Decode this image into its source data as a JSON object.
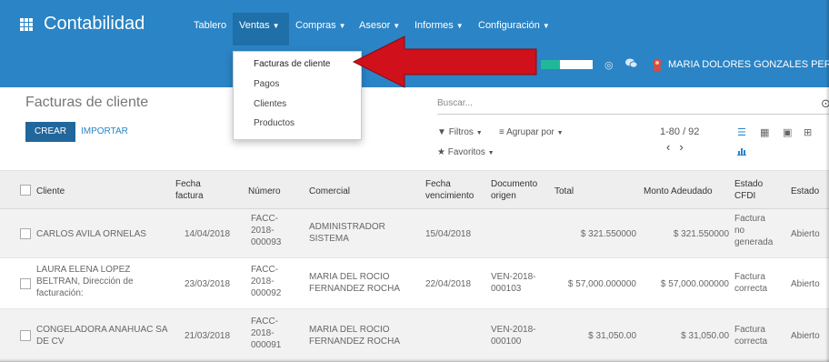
{
  "app": {
    "title": "Contabilidad",
    "apps_icon": "grid-icon"
  },
  "nav": {
    "tablero": "Tablero",
    "ventas": "Ventas",
    "compras": "Compras",
    "asesor": "Asesor",
    "informes": "Informes",
    "configuracion": "Configuración"
  },
  "dropdown": {
    "items": [
      "Facturas de cliente",
      "Pagos",
      "Clientes",
      "Productos"
    ],
    "active_index": 0
  },
  "topbar": {
    "progress_fraction": 0.37,
    "progress_colors": {
      "fill": "#21b799",
      "track": "#ffffff"
    },
    "user_name": "MARIA DOLORES GONZALES PERE"
  },
  "control": {
    "title": "Facturas de cliente",
    "crear": "CREAR",
    "importar": "IMPORTAR",
    "search_placeholder": "Buscar...",
    "filtros": "Filtros",
    "agrupar": "Agrupar por",
    "favoritos": "Favoritos",
    "pager": "1-80 / 92"
  },
  "table": {
    "headers": {
      "cliente": "Cliente",
      "fecha_factura_1": "Fecha",
      "fecha_factura_2": "factura",
      "numero": "Número",
      "comercial": "Comercial",
      "fecha_venc_1": "Fecha",
      "fecha_venc_2": "vencimiento",
      "documento_1": "Documento",
      "documento_2": "origen",
      "total": "Total",
      "monto": "Monto Adeudado",
      "estado_cfdi_1": "Estado",
      "estado_cfdi_2": "CFDI",
      "estado": "Estado"
    },
    "rows": [
      {
        "cliente": [
          "CARLOS AVILA ORNELAS"
        ],
        "fecha": "14/04/2018",
        "numero": [
          "FACC-",
          "2018-",
          "000093"
        ],
        "comercial": [
          "ADMINISTRADOR",
          "SISTEMA"
        ],
        "vencimiento": "15/04/2018",
        "documento": [],
        "total": "$ 321.550000",
        "monto": "$ 321.550000",
        "cfdi": [
          "Factura",
          "no",
          "generada"
        ],
        "estado": "Abierto"
      },
      {
        "cliente": [
          "LAURA ELENA LOPEZ",
          "BELTRAN, Dirección de",
          "facturación:"
        ],
        "fecha": "23/03/2018",
        "numero": [
          "FACC-",
          "2018-",
          "000092"
        ],
        "comercial": [
          "MARIA DEL ROCIO",
          "FERNANDEZ ROCHA"
        ],
        "vencimiento": "22/04/2018",
        "documento": [
          "VEN-2018-",
          "000103"
        ],
        "total": "$ 57,000.000000",
        "monto": "$ 57,000.000000",
        "cfdi": [
          "Factura",
          "correcta"
        ],
        "estado": "Abierto"
      },
      {
        "cliente": [
          "CONGELADORA ANAHUAC SA",
          "DE CV"
        ],
        "fecha": "21/03/2018",
        "numero": [
          "FACC-",
          "2018-",
          "000091"
        ],
        "comercial": [
          "MARIA DEL ROCIO",
          "FERNANDEZ ROCHA"
        ],
        "vencimiento": "",
        "documento": [
          "VEN-2018-",
          "000100"
        ],
        "total": "$ 31,050.00",
        "monto": "$ 31,050.00",
        "cfdi": [
          "Factura",
          "correcta"
        ],
        "estado": "Abierto"
      }
    ]
  },
  "colors": {
    "navbar": "#2b84c5",
    "primary_button": "#21679b",
    "arrow": "#d0101b"
  }
}
